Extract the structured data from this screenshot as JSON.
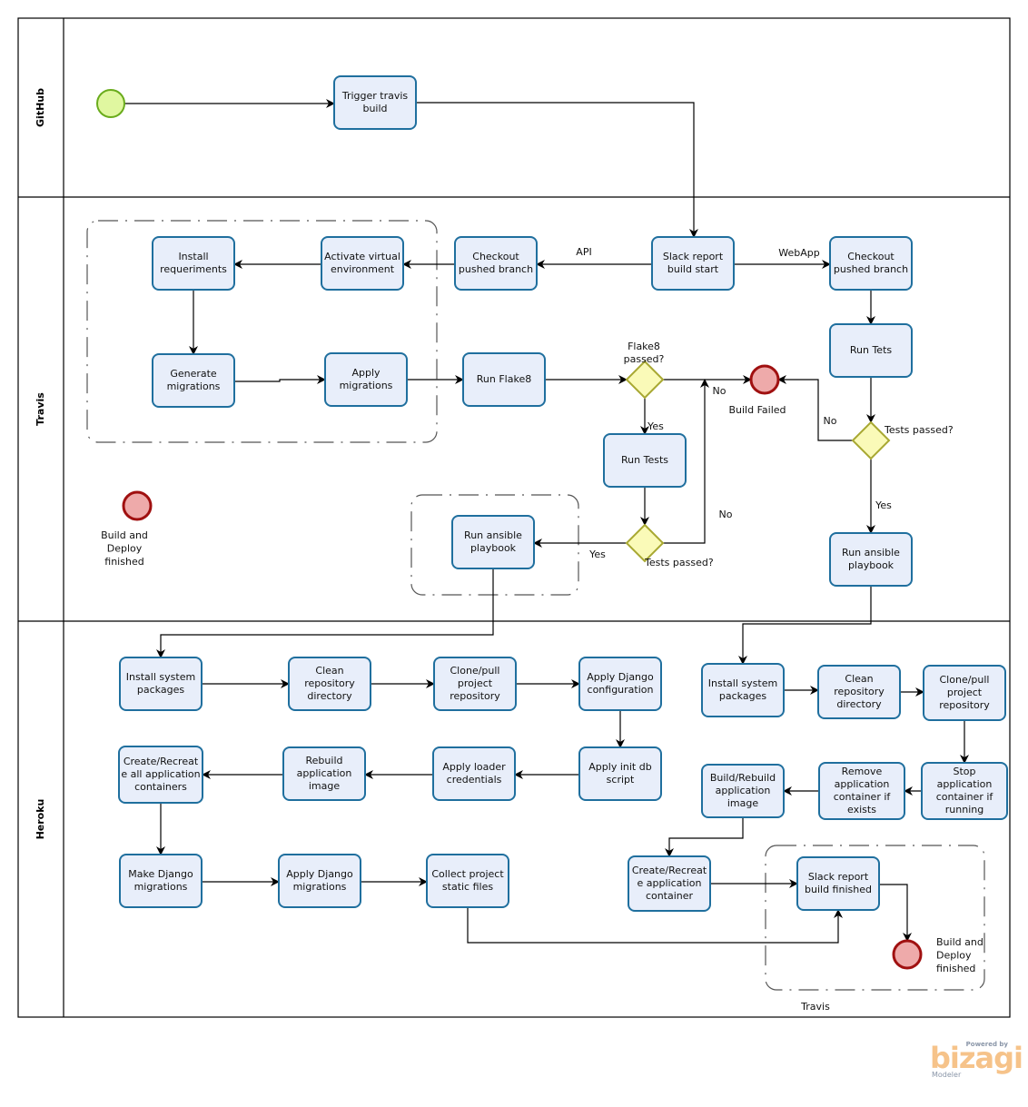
{
  "lanes": [
    {
      "id": "github",
      "label": "GitHub"
    },
    {
      "id": "travis",
      "label": "Travis"
    },
    {
      "id": "heroku",
      "label": "Heroku"
    }
  ],
  "colors": {
    "task_fill": "#e8eefa",
    "task_stroke": "#1f6f9e",
    "gateway_fill": "#fafab8",
    "gateway_stroke": "#a8a832",
    "start_fill": "#e0f7a0",
    "start_stroke": "#6aac1c",
    "end_fill": "#eeaaaa",
    "end_stroke": "#a01010"
  },
  "tasks": [
    {
      "id": "t_trigger",
      "lines": [
        "Trigger travis",
        "build"
      ]
    },
    {
      "id": "t_install_req",
      "lines": [
        "Install",
        "requeriments"
      ]
    },
    {
      "id": "t_activate",
      "lines": [
        "Activate virtual",
        "environment"
      ]
    },
    {
      "id": "t_checkout_api",
      "lines": [
        "Checkout",
        "pushed branch"
      ]
    },
    {
      "id": "t_slack_start",
      "lines": [
        "Slack report",
        "build start"
      ]
    },
    {
      "id": "t_checkout_web",
      "lines": [
        "Checkout",
        "pushed branch"
      ]
    },
    {
      "id": "t_gen_mig",
      "lines": [
        "Generate",
        "migrations"
      ]
    },
    {
      "id": "t_apply_mig",
      "lines": [
        "Apply",
        "migrations"
      ]
    },
    {
      "id": "t_flake8",
      "lines": [
        "Run Flake8"
      ]
    },
    {
      "id": "t_run_tets",
      "lines": [
        "Run Tets"
      ]
    },
    {
      "id": "t_run_tests",
      "lines": [
        "Run Tests"
      ]
    },
    {
      "id": "t_ansible_api",
      "lines": [
        "Run  ansible",
        "playbook"
      ]
    },
    {
      "id": "t_ansible_web",
      "lines": [
        "Run  ansible",
        "playbook"
      ]
    },
    {
      "id": "h_install_sys",
      "lines": [
        "Install system",
        "packages"
      ]
    },
    {
      "id": "h_clean",
      "lines": [
        "Clean",
        "repository",
        "directory"
      ]
    },
    {
      "id": "h_clone",
      "lines": [
        "Clone/pull",
        "project",
        "repository"
      ]
    },
    {
      "id": "h_django_cfg",
      "lines": [
        "Apply  Django",
        "configuration"
      ]
    },
    {
      "id": "h_init_db",
      "lines": [
        "Apply init db",
        "script"
      ]
    },
    {
      "id": "h_loader",
      "lines": [
        "Apply loader",
        "credentials"
      ]
    },
    {
      "id": "h_rebuild",
      "lines": [
        "Rebuild",
        "application",
        "image"
      ]
    },
    {
      "id": "h_create_all",
      "lines": [
        "Create/Recreat",
        "e all application",
        "containers"
      ]
    },
    {
      "id": "h_make_mig",
      "lines": [
        "Make Django",
        "migrations"
      ]
    },
    {
      "id": "h_apply_mig",
      "lines": [
        "Apply Django",
        "migrations"
      ]
    },
    {
      "id": "h_collect",
      "lines": [
        "Collect  project",
        "static files"
      ]
    },
    {
      "id": "w_install_sys",
      "lines": [
        "Install system",
        "packages"
      ]
    },
    {
      "id": "w_clean",
      "lines": [
        "Clean",
        "repository",
        "directory"
      ]
    },
    {
      "id": "w_clone",
      "lines": [
        "Clone/pull",
        "project",
        "repository"
      ]
    },
    {
      "id": "w_stop",
      "lines": [
        "Stop",
        "application",
        "container if",
        "running"
      ]
    },
    {
      "id": "w_remove",
      "lines": [
        "Remove",
        "application",
        "container if",
        "exists"
      ]
    },
    {
      "id": "w_build",
      "lines": [
        "Build/Rebuild",
        "application",
        "image"
      ]
    },
    {
      "id": "w_create",
      "lines": [
        "Create/Recreat",
        "e application",
        "container"
      ]
    },
    {
      "id": "w_slack_finish",
      "lines": [
        "Slack report",
        "build finished"
      ]
    }
  ],
  "gateways": [
    {
      "id": "g_flake8",
      "label_lines": [
        "Flake8",
        "passed?"
      ]
    },
    {
      "id": "g_tests_api",
      "label_lines": [
        "Tests passed?"
      ]
    },
    {
      "id": "g_tests_web",
      "label_lines": [
        "Tests passed?"
      ]
    }
  ],
  "events": [
    {
      "id": "e_start",
      "type": "start",
      "label_lines": []
    },
    {
      "id": "e_build_failed",
      "type": "end",
      "label_lines": [
        "Build Failed"
      ]
    },
    {
      "id": "e_finished_left",
      "type": "end",
      "label_lines": [
        "Build and",
        "Deploy",
        "finished"
      ]
    },
    {
      "id": "e_finished_right",
      "type": "end",
      "label_lines": [
        "Build and",
        "Deploy",
        "finished"
      ]
    }
  ],
  "flow_labels": {
    "api": "API",
    "webapp": "WebApp",
    "flake8_no": "No",
    "flake8_yes": "Yes",
    "tests_api_no": "No",
    "tests_api_yes": "Yes",
    "tests_web_no": "No",
    "tests_web_yes": "Yes"
  },
  "groups": [
    {
      "id": "grp_venv",
      "label": ""
    },
    {
      "id": "grp_ansible",
      "label": ""
    },
    {
      "id": "grp_travis_finish",
      "label": "Travis"
    }
  ],
  "branding": {
    "powered_by": "Powered by",
    "name": "bizagi",
    "product": "Modeler"
  }
}
